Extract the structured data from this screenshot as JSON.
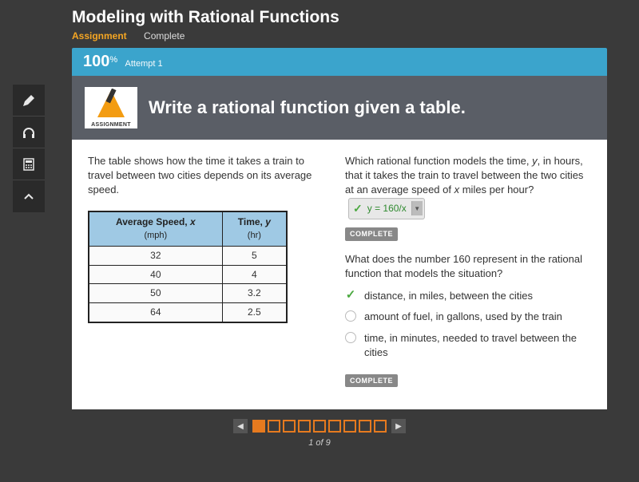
{
  "title": "Modeling with Rational Functions",
  "subhead": {
    "assignment": "Assignment",
    "complete": "Complete"
  },
  "scorebar": {
    "score": "100",
    "pct": "%",
    "attempt": "Attempt 1"
  },
  "assign_icon_label": "ASSIGNMENT",
  "instruction": "Write a rational function given a table.",
  "left": {
    "intro": "The table shows how the time it takes a train to travel between two cities depends on its average speed.",
    "col1_head": "Average Speed, ",
    "col1_var": "x",
    "col1_unit": "(mph)",
    "col2_head": "Time, ",
    "col2_var": "y",
    "col2_unit": "(hr)",
    "rows": [
      {
        "speed": "32",
        "time": "5"
      },
      {
        "speed": "40",
        "time": "4"
      },
      {
        "speed": "50",
        "time": "3.2"
      },
      {
        "speed": "64",
        "time": "2.5"
      }
    ]
  },
  "right": {
    "q1a": "Which rational function models the time, ",
    "q1b": ", in hours, that it takes the train to travel between the two cities at an average speed of ",
    "q1c": " miles per hour?",
    "var_y": "y",
    "var_x": "x",
    "answer_formula": "y = 160/x",
    "complete_label": "COMPLETE",
    "q2": "What does the number 160 represent in the rational function that models the situation?",
    "options": [
      {
        "text": "distance, in miles, between the cities",
        "correct": true
      },
      {
        "text": "amount of fuel, in gallons, used by the train",
        "correct": false
      },
      {
        "text": "time, in minutes, needed to travel between the cities",
        "correct": false
      }
    ]
  },
  "pager": {
    "current": 1,
    "total": 9,
    "label": "1 of 9"
  }
}
